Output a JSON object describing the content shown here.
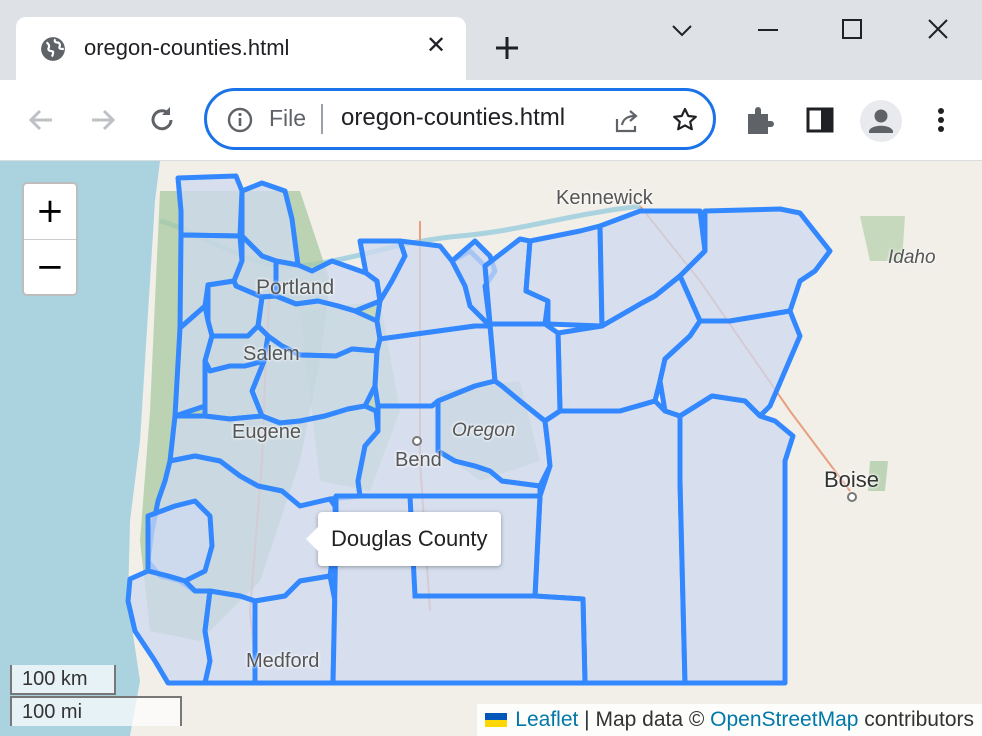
{
  "browser": {
    "tab_title": "oregon-counties.html",
    "tab_close": "✕",
    "file_label": "File",
    "url": "oregon-counties.html"
  },
  "map": {
    "zoom_in": "+",
    "zoom_out": "−",
    "tooltip": "Douglas County",
    "scale_km": "100 km",
    "scale_mi": "100 mi",
    "attribution": {
      "leaflet": "Leaflet",
      "separator": " | Map data © ",
      "osm": "OpenStreetMap",
      "suffix": " contributors"
    },
    "place_labels": {
      "kennewick": "Kennewick",
      "idaho": "Idaho",
      "portland": "Portland",
      "salem": "Salem",
      "eugene": "Eugene",
      "oregon": "Oregon",
      "bend": "Bend",
      "boise": "Boise",
      "medford": "Medford"
    },
    "colors": {
      "county_fill": "#cddaf0",
      "county_stroke": "#3388ff",
      "water": "#aad3df",
      "forest": "#a8c9a0"
    }
  }
}
